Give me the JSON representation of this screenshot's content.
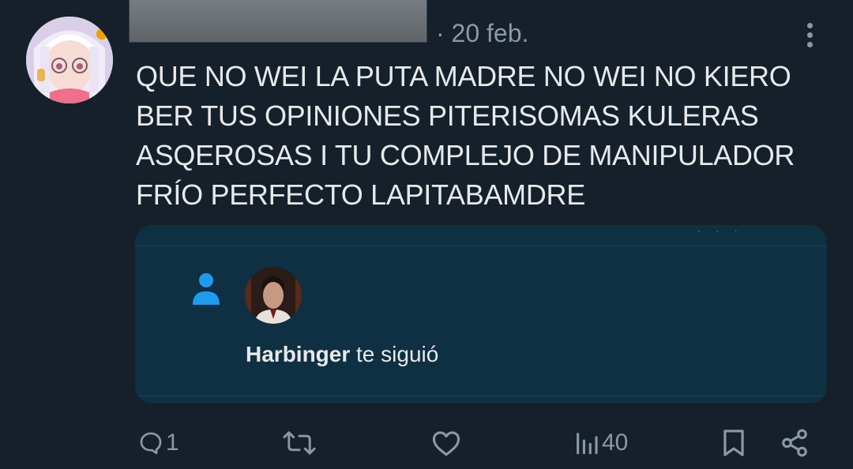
{
  "tweet": {
    "time": "· 20 feb.",
    "text": "QUE NO WEI LA PUTA MADRE NO WEI NO KIERO\nBER TUS OPINIONES PITERISOMAS KULERAS\nASQEROSAS I TU COMPLEJO DE MANIPULADOR\nFRÍO PERFECTO LAPITABAMDRE"
  },
  "notification": {
    "name": "Harbinger",
    "action": " te siguió"
  },
  "actions": {
    "replies": "1",
    "reposts": "",
    "likes": "",
    "views": "40"
  },
  "colors": {
    "background": "#15202b",
    "card": "#0f3043",
    "accent": "#1d9bf0",
    "muted": "#8b98a5",
    "text": "#e7e9ea"
  },
  "icons": [
    "more-icon",
    "person-icon",
    "reply-icon",
    "repost-icon",
    "like-icon",
    "views-icon",
    "bookmark-icon",
    "share-icon"
  ]
}
